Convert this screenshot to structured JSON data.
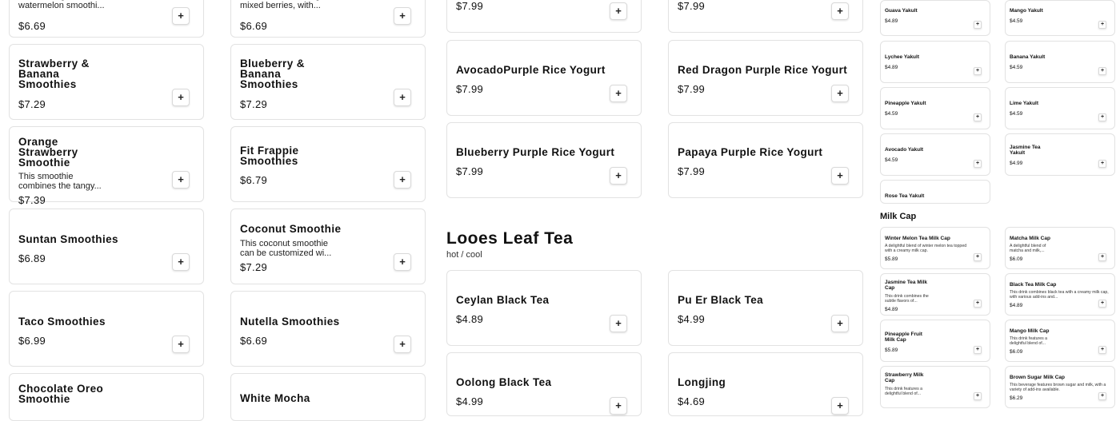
{
  "add_symbol": "+",
  "smoothies_col1": [
    {
      "name": "",
      "desc": "A refreshing watermelon smoothi...",
      "price": "$6.69"
    },
    {
      "name": "Strawberry &\nBanana\nSmoothies",
      "desc": "",
      "price": "$7.29"
    },
    {
      "name": "Orange\nStrawberry\nSmoothie",
      "desc": "This smoothie combines the tangy...",
      "price": "$7.39"
    },
    {
      "name": "Suntan Smoothies",
      "desc": "",
      "price": "$6.89"
    },
    {
      "name": "Taco Smoothies",
      "desc": "",
      "price": "$6.99"
    },
    {
      "name": "Chocolate Oreo\nSmoothie",
      "desc": "",
      "price": ""
    }
  ],
  "smoothies_col2": [
    {
      "name": "",
      "desc": "A smoothie featuring mixed berries, with...",
      "price": "$6.69"
    },
    {
      "name": "Blueberry &\nBanana\nSmoothies",
      "desc": "",
      "price": "$7.29"
    },
    {
      "name": "Fit Frappie\nSmoothies",
      "desc": "",
      "price": "$6.79"
    },
    {
      "name": "Coconut Smoothie",
      "desc": "This coconut smoothie can be customized wi...",
      "price": "$7.29"
    },
    {
      "name": "Nutella Smoothies",
      "desc": "",
      "price": "$6.69"
    },
    {
      "name": "White Mocha",
      "desc": "",
      "price": ""
    }
  ],
  "rice_yogurt_col1": [
    {
      "name": "",
      "price": "$7.99"
    },
    {
      "name": "AvocadoPurple Rice Yogurt",
      "price": "$7.99"
    },
    {
      "name": "Blueberry Purple Rice Yogurt",
      "price": "$7.99"
    }
  ],
  "rice_yogurt_col2": [
    {
      "name": "",
      "price": "$7.99"
    },
    {
      "name": "Red Dragon Purple Rice Yogurt",
      "price": "$7.99"
    },
    {
      "name": "Papaya Purple Rice Yogurt",
      "price": "$7.99"
    }
  ],
  "tea_section": {
    "title": "Looes Leaf Tea",
    "subtitle": "hot / cool"
  },
  "tea_col1": [
    {
      "name": "Ceylan Black Tea",
      "price": "$4.89"
    },
    {
      "name": "Oolong Black Tea",
      "price": "$4.99"
    }
  ],
  "tea_col2": [
    {
      "name": "Pu Er Black Tea",
      "price": "$4.99"
    },
    {
      "name": "Longjing",
      "price": "$4.69"
    }
  ],
  "yakult_col1": [
    {
      "name": "Guava Yakult",
      "price": "$4.89"
    },
    {
      "name": "Lychee Yakult",
      "price": "$4.89"
    },
    {
      "name": "Pineapple Yakult",
      "price": "$4.59"
    },
    {
      "name": "Avocado Yakult",
      "price": "$4.59"
    },
    {
      "name": "Rose Tea Yakult",
      "price": ""
    }
  ],
  "yakult_col2": [
    {
      "name": "Mango Yakult",
      "price": "$4.59"
    },
    {
      "name": "Banana Yakult",
      "price": "$4.59"
    },
    {
      "name": "Lime Yakult",
      "price": "$4.59"
    },
    {
      "name": "Jasmine Tea\nYakult",
      "price": "$4.99"
    }
  ],
  "milk_cap_section": {
    "title": "Milk Cap"
  },
  "milkcap_col1": [
    {
      "name": "Winter Melon Tea Milk Cap",
      "desc": "A delightful blend of winter melon tea topped with a creamy milk cap.",
      "price": "$5.89"
    },
    {
      "name": "Jasmine Tea Milk\nCap",
      "desc": "This drink combines the subtle flavors of...",
      "price": "$4.89"
    },
    {
      "name": "Pineapple Fruit\nMilk Cap",
      "desc": "",
      "price": "$5.89"
    },
    {
      "name": "Strawberry Milk\nCap",
      "desc": "This drink features a delightful blend of...",
      "price": ""
    }
  ],
  "milkcap_col2": [
    {
      "name": "Matcha Milk Cap",
      "desc": "A delightful blend of matcha and milk,...",
      "price": "$6.09"
    },
    {
      "name": "Black Tea Milk Cap",
      "desc": "This drink combines black tea with a creamy milk cap, with various add-ins and...",
      "price": "$4.89"
    },
    {
      "name": "Mango Milk Cap",
      "desc": "This drink features a delightful blend of...",
      "price": "$6.09"
    },
    {
      "name": "Brown Sugar Milk Cap",
      "desc": "This beverage features brown sugar and milk, with a variety of add-ins available.",
      "price": "$6.29"
    }
  ]
}
